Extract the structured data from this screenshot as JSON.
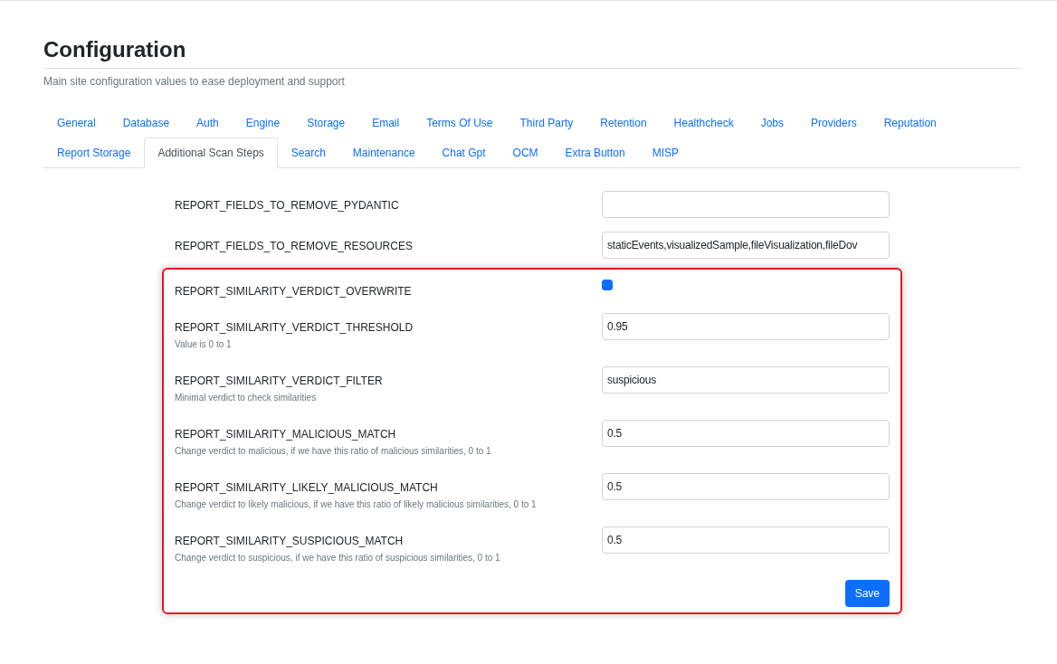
{
  "header": {
    "title": "Configuration",
    "subtitle": "Main site configuration values to ease deployment and support"
  },
  "tabs": [
    {
      "label": "General",
      "selected": false
    },
    {
      "label": "Database",
      "selected": false
    },
    {
      "label": "Auth",
      "selected": false
    },
    {
      "label": "Engine",
      "selected": false
    },
    {
      "label": "Storage",
      "selected": false
    },
    {
      "label": "Email",
      "selected": false
    },
    {
      "label": "Terms Of Use",
      "selected": false
    },
    {
      "label": "Third Party",
      "selected": false
    },
    {
      "label": "Retention",
      "selected": false
    },
    {
      "label": "Healthcheck",
      "selected": false
    },
    {
      "label": "Jobs",
      "selected": false
    },
    {
      "label": "Providers",
      "selected": false
    },
    {
      "label": "Reputation",
      "selected": false
    },
    {
      "label": "Report Storage",
      "selected": false
    },
    {
      "label": "Additional Scan Steps",
      "selected": true
    },
    {
      "label": "Search",
      "selected": false
    },
    {
      "label": "Maintenance",
      "selected": false
    },
    {
      "label": "Chat Gpt",
      "selected": false
    },
    {
      "label": "OCM",
      "selected": false
    },
    {
      "label": "Extra Button",
      "selected": false
    },
    {
      "label": "MISP",
      "selected": false
    }
  ],
  "settings": [
    {
      "kind": "text",
      "name": "REPORT_FIELDS_TO_REMOVE_PYDANTIC"
    },
    {
      "kind": "text",
      "name": "REPORT_FIELDS_TO_REMOVE_RESOURCES",
      "value": "staticEvents,visualizedSample,fileVisualization,fileDov"
    }
  ],
  "highlighted_section": {
    "settings": [
      {
        "kind": "checkbox",
        "name": "REPORT_SIMILARITY_VERDICT_OVERWRITE",
        "checked": true
      },
      {
        "kind": "text",
        "name": "REPORT_SIMILARITY_VERDICT_THRESHOLD",
        "hint": "Value is 0 to 1",
        "value": "0.95"
      },
      {
        "kind": "text",
        "name": "REPORT_SIMILARITY_VERDICT_FILTER",
        "hint": "Minimal verdict to check similarities",
        "value": "suspicious"
      },
      {
        "kind": "text",
        "name": "REPORT_SIMILARITY_MALICIOUS_MATCH",
        "hint": "Change verdict to malicious, if we have this ratio of malicious similarities, 0 to 1",
        "value": "0.5"
      },
      {
        "kind": "text",
        "name": "REPORT_SIMILARITY_LIKELY_MALICIOUS_MATCH",
        "hint": "Change verdict to likely malicious, if we have this ratio of likely malicious similarities, 0 to 1",
        "value": "0.5"
      },
      {
        "kind": "text",
        "name": "REPORT_SIMILARITY_SUSPICIOUS_MATCH",
        "hint": "Change verdict to suspicious, if we have this ratio of suspicious similarities, 0 to 1",
        "value": "0.5"
      }
    ],
    "save_button": "Save"
  }
}
